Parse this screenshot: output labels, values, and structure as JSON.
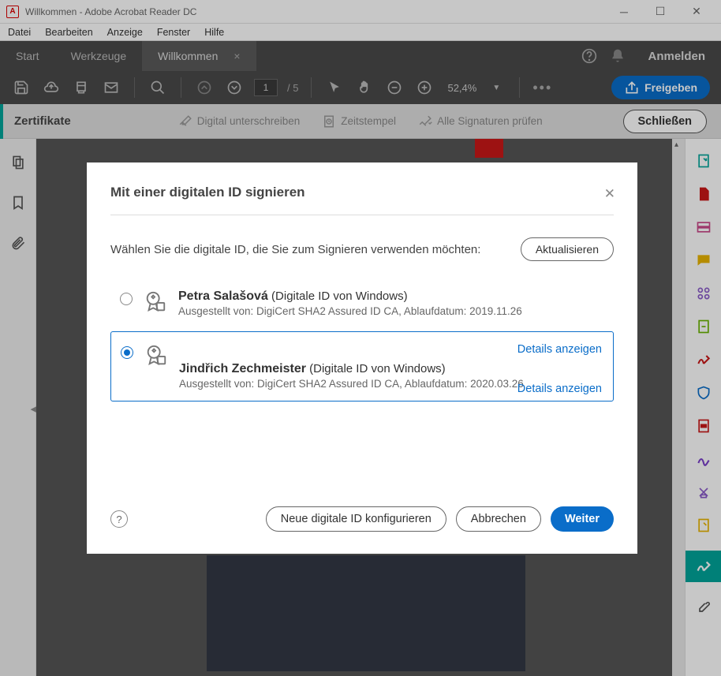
{
  "window": {
    "title": "Willkommen - Adobe Acrobat Reader DC"
  },
  "menu": {
    "file": "Datei",
    "edit": "Bearbeiten",
    "view": "Anzeige",
    "window": "Fenster",
    "help": "Hilfe"
  },
  "tabs": {
    "start": "Start",
    "tools": "Werkzeuge",
    "welcome": "Willkommen",
    "login": "Anmelden"
  },
  "toolbar": {
    "page_current": "1",
    "page_total": "/  5",
    "zoom": "52,4%",
    "share": "Freigeben"
  },
  "certbar": {
    "label": "Zertifikate",
    "sign": "Digital unterschreiben",
    "timestamp": "Zeitstempel",
    "verify": "Alle Signaturen prüfen",
    "close": "Schließen"
  },
  "modal": {
    "title": "Mit einer digitalen ID signieren",
    "prompt": "Wählen Sie die digitale ID, die Sie zum Signieren verwenden möchten:",
    "refresh": "Aktualisieren",
    "details": "Details anzeigen",
    "configure": "Neue digitale ID konfigurieren",
    "cancel": "Abbrechen",
    "next": "Weiter",
    "ids": [
      {
        "name": "Petra Salašová",
        "source": "(Digitale ID von Windows)",
        "issued": "Ausgestellt von: DigiCert SHA2 Assured ID CA, Ablaufdatum: 2019.11.26"
      },
      {
        "name": "Jindřich Zechmeister",
        "source": "(Digitale ID von Windows)",
        "issued": "Ausgestellt von: DigiCert SHA2 Assured ID CA, Ablaufdatum: 2020.03.26"
      }
    ]
  }
}
